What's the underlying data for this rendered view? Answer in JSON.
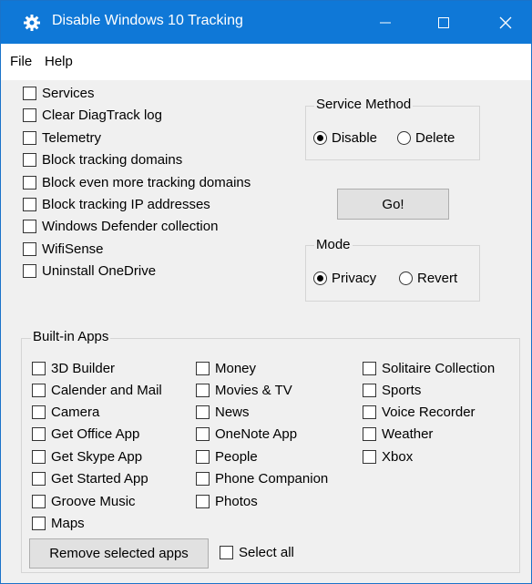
{
  "window": {
    "title": "Disable Windows 10 Tracking",
    "gear_icon": "gear-icon"
  },
  "titlebar_controls": {
    "minimize": "—",
    "maximize": "☐",
    "close": "✕"
  },
  "menu": {
    "file": "File",
    "help": "Help"
  },
  "options": [
    "Services",
    "Clear DiagTrack log",
    "Telemetry",
    "Block tracking domains",
    "Block even more tracking domains",
    "Block tracking IP addresses",
    "Windows Defender collection",
    "WifiSense",
    "Uninstall OneDrive"
  ],
  "service_method": {
    "label": "Service Method",
    "disable": "Disable",
    "delete": "Delete",
    "selected": "Disable"
  },
  "go_button": "Go!",
  "mode": {
    "label": "Mode",
    "privacy": "Privacy",
    "revert": "Revert",
    "selected": "Privacy"
  },
  "builtin_apps": {
    "label": "Built-in Apps",
    "col1": [
      "3D Builder",
      "Calender and Mail",
      "Camera",
      "Get Office App",
      "Get Skype App",
      "Get Started App",
      "Groove Music",
      "Maps"
    ],
    "col2": [
      "Money",
      "Movies & TV",
      "News",
      "OneNote App",
      "People",
      "Phone Companion",
      "Photos"
    ],
    "col3": [
      "Solitaire Collection",
      "Sports",
      "Voice Recorder",
      "Weather",
      "Xbox"
    ]
  },
  "remove_button": "Remove selected apps",
  "select_all": "Select all"
}
